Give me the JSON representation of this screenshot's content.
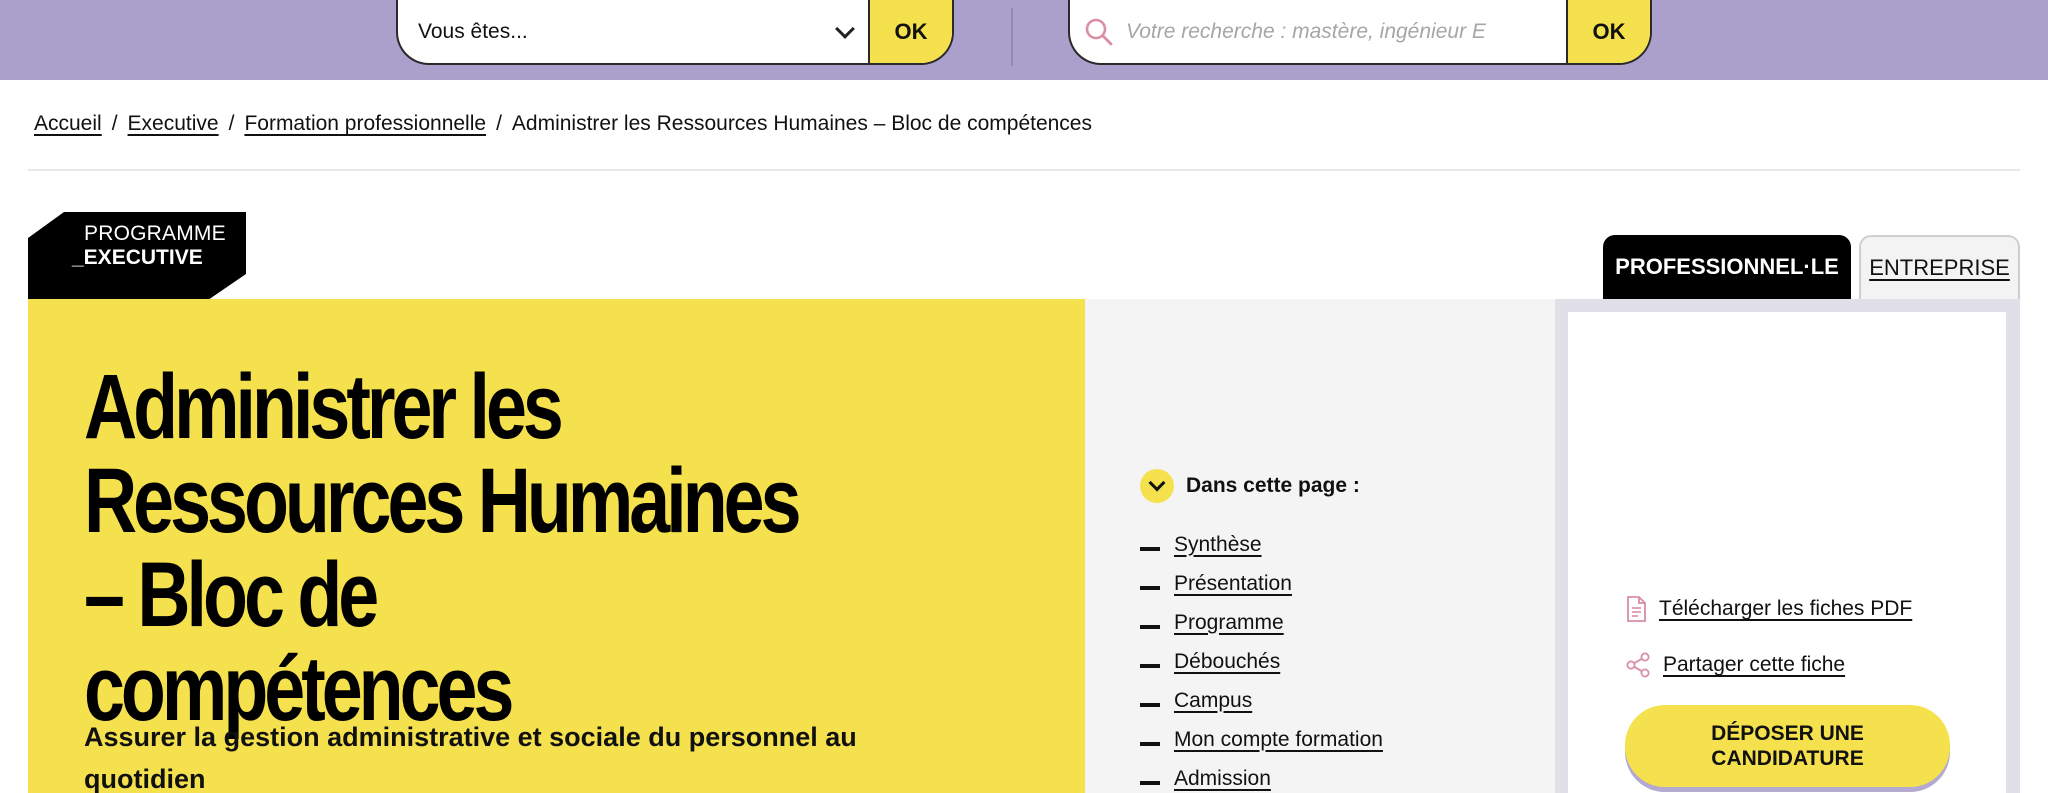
{
  "topbar": {
    "profile_select": {
      "value": "Vous êtes..."
    },
    "profile_ok_label": "OK",
    "search": {
      "placeholder": "Votre recherche : mastère, ingénieur E"
    },
    "search_ok_label": "OK"
  },
  "breadcrumb": {
    "items": [
      {
        "label": "Accueil"
      },
      {
        "label": "Executive"
      },
      {
        "label": "Formation professionnelle"
      }
    ],
    "current": "Administrer les Ressources Humaines – Bloc de compétences",
    "separator": "/"
  },
  "badge": {
    "line1": "PROGRAMME",
    "line2": "_EXECUTIVE"
  },
  "tabs": [
    {
      "label": "PROFESSIONNEL·LE",
      "active": true
    },
    {
      "label": "ENTREPRISE",
      "active": false
    }
  ],
  "hero": {
    "title": "Administrer les Ressources Humaines – Bloc de compétences",
    "subtitle": "Assurer la gestion administrative et sociale du personnel au quotidien"
  },
  "toc": {
    "heading": "Dans cette page :",
    "items": [
      {
        "label": "Synthèse"
      },
      {
        "label": "Présentation"
      },
      {
        "label": "Programme"
      },
      {
        "label": "Débouchés"
      },
      {
        "label": "Campus"
      },
      {
        "label": "Mon compte formation"
      },
      {
        "label": "Admission"
      }
    ]
  },
  "sidecard": {
    "download_label": "Télécharger les fiches PDF",
    "share_label": "Partager cette fiche",
    "cta_line1": "DÉPOSER UNE",
    "cta_line2": "CANDIDATURE"
  },
  "colors": {
    "topbar": "#ab9fcc",
    "accent_yellow": "#f5e14d",
    "black": "#000000",
    "panel_grey": "#f4f4f4",
    "icon_pink": "#d98ea3"
  },
  "icons": {
    "select_caret": "chevron-down-icon",
    "search": "search-icon",
    "toc_toggle": "chevron-down-icon",
    "download": "document-icon",
    "share": "share-icon"
  }
}
